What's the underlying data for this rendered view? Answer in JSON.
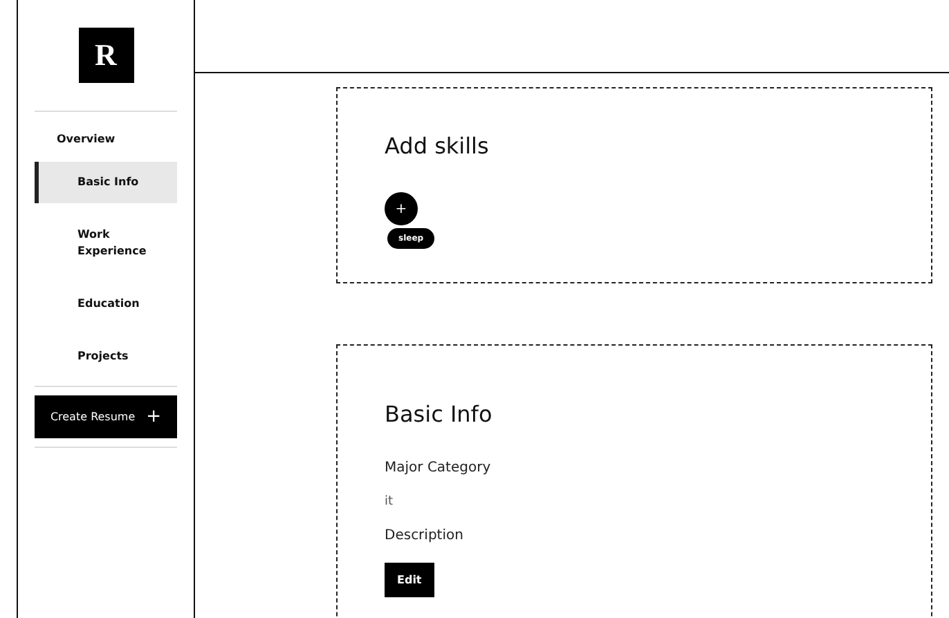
{
  "logo": "R",
  "sidebar": {
    "overview": "Overview",
    "items": [
      {
        "label": "Basic Info",
        "selected": true
      },
      {
        "label": "Work\nExperience",
        "selected": false
      },
      {
        "label": "Education",
        "selected": false
      },
      {
        "label": "Projects",
        "selected": false
      }
    ],
    "create_button": {
      "label": "Create Resume",
      "icon": "+"
    }
  },
  "skills": {
    "title": "Add skills",
    "add_button": "+",
    "tags": [
      "sleep"
    ]
  },
  "basic_info": {
    "title": "Basic Info",
    "fields": [
      {
        "label": "Major Category",
        "value": "it"
      },
      {
        "label": "Description"
      }
    ],
    "edit_button": "Edit"
  }
}
